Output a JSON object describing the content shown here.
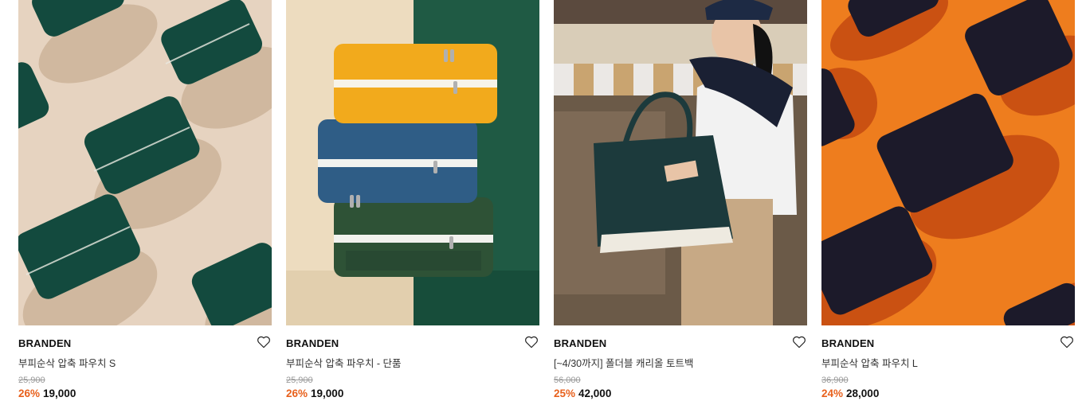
{
  "products": [
    {
      "brand": "BRANDEN",
      "name": "부피순삭 압축 파우치 S",
      "original_price": "25,900",
      "discount": "26%",
      "price": "19,000",
      "image_desc": "green compression pouches on beige",
      "wishlist_icon": "heart-outline-icon"
    },
    {
      "brand": "BRANDEN",
      "name": "부피순삭 압축 파우치 - 단품",
      "original_price": "25,900",
      "discount": "26%",
      "price": "19,000",
      "image_desc": "stack of yellow, blue and green pouches",
      "wishlist_icon": "heart-outline-icon"
    },
    {
      "brand": "BRANDEN",
      "name": "[~4/30까지] 폴더블 캐리올 토트백",
      "original_price": "56,000",
      "discount": "25%",
      "price": "42,000",
      "image_desc": "woman carrying dark green tote bag",
      "wishlist_icon": "heart-outline-icon"
    },
    {
      "brand": "BRANDEN",
      "name": "부피순삭 압축 파우치 L",
      "original_price": "36,900",
      "discount": "24%",
      "price": "28,000",
      "image_desc": "black pouches on orange",
      "wishlist_icon": "heart-outline-icon"
    }
  ],
  "colors": {
    "discount": "#e8611d",
    "text": "#111111",
    "muted": "#999999"
  }
}
